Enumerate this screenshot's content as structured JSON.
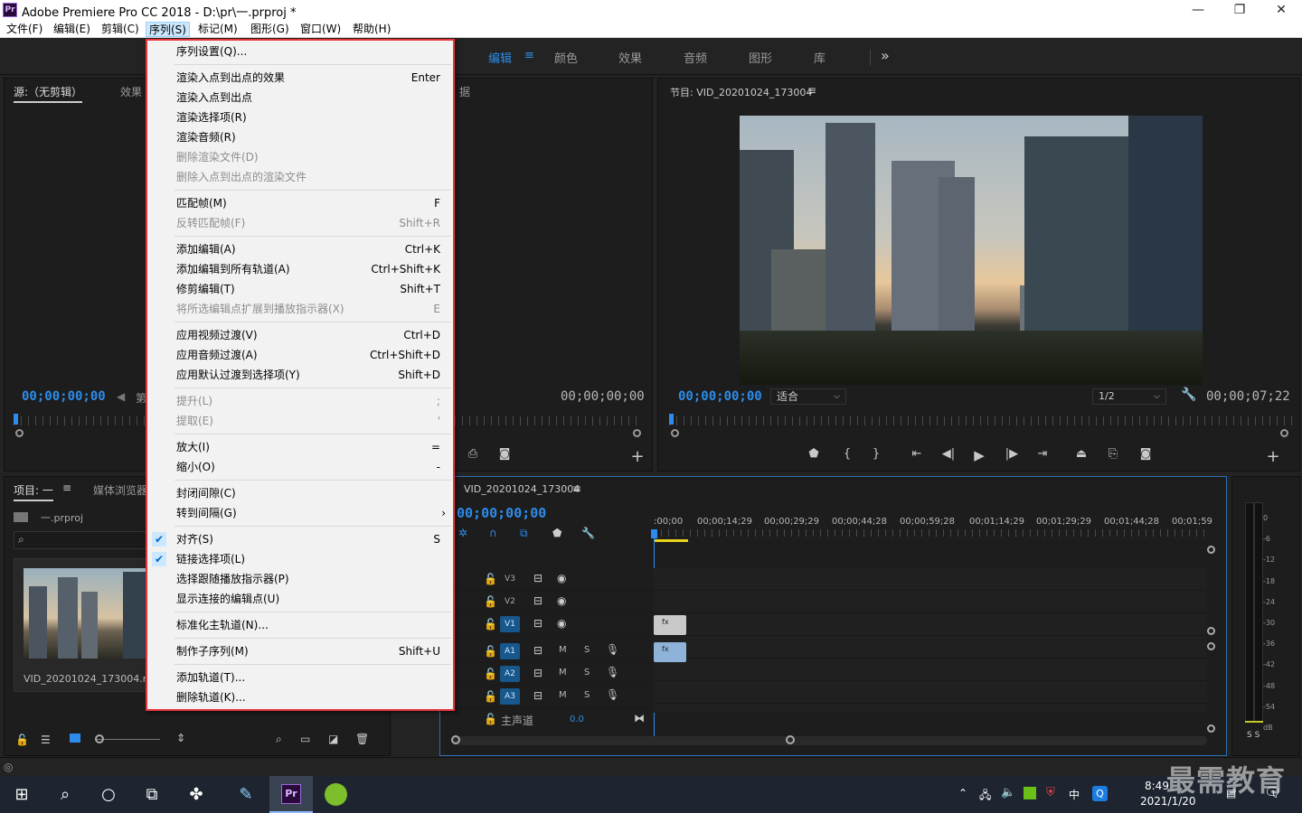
{
  "window": {
    "title": "Adobe Premiere Pro CC 2018 - D:\\pr\\一.prproj *",
    "logo_text": "Pr",
    "minimize": "—",
    "restore": "❐",
    "close": "✕"
  },
  "menubar": [
    {
      "label": "文件(F)"
    },
    {
      "label": "编辑(E)"
    },
    {
      "label": "剪辑(C)"
    },
    {
      "label": "序列(S)",
      "active": true
    },
    {
      "label": "标记(M)"
    },
    {
      "label": "图形(G)"
    },
    {
      "label": "窗口(W)"
    },
    {
      "label": "帮助(H)"
    }
  ],
  "workspace_tabs": [
    {
      "label": "编辑",
      "active": true
    },
    {
      "label": "颜色"
    },
    {
      "label": "效果"
    },
    {
      "label": "音频"
    },
    {
      "label": "图形"
    },
    {
      "label": "库"
    }
  ],
  "workspace_more": "»",
  "source_panel": {
    "tab_source": "源:（无剪辑）",
    "tab_effects": "效果",
    "tab_cut": "第",
    "tab_metadata_tail": "据",
    "timecode_left": "00;00;00;00",
    "timecode_right": "00;00;00;00"
  },
  "program_panel": {
    "title": "节目: VID_20201024_173004",
    "timecode_left": "00;00;00;00",
    "fit": "适合",
    "resolution": "1/2",
    "timecode_right": "00;00;07;22"
  },
  "project_panel": {
    "tab_project": "项目: 一",
    "tab_media": "媒体浏览器",
    "project_file": "一.prproj",
    "clip_name": "VID_20201024_173004.mp4"
  },
  "timeline": {
    "sequence_name": "VID_20201024_173004",
    "timecode": "00;00;00;00",
    "ruler_labels": [
      ":00;00",
      "00;00;14;29",
      "00;00;29;29",
      "00;00;44;28",
      "00;00;59;28",
      "00;01;14;29",
      "00;01;29;29",
      "00;01;44;28",
      "00;01;59"
    ],
    "video_tracks": [
      "V3",
      "V2",
      "V1"
    ],
    "audio_tracks": [
      "A1",
      "A2",
      "A3"
    ],
    "master_label": "主声道",
    "master_value": "0.0",
    "mute": "M",
    "solo": "S"
  },
  "audio_meter": {
    "labels": [
      "0",
      "-6",
      "-12",
      "-18",
      "-24",
      "-30",
      "-36",
      "-42",
      "-48",
      "-54",
      "dB"
    ],
    "solo_labels": "S S"
  },
  "sequence_menu": {
    "groups": [
      [
        {
          "label": "序列设置(Q)...",
          "shortcut": ""
        }
      ],
      [
        {
          "label": "渲染入点到出点的效果",
          "shortcut": "Enter"
        },
        {
          "label": "渲染入点到出点",
          "shortcut": ""
        },
        {
          "label": "渲染选择项(R)",
          "shortcut": ""
        },
        {
          "label": "渲染音频(R)",
          "shortcut": ""
        },
        {
          "label": "删除渲染文件(D)",
          "shortcut": "",
          "disabled": true
        },
        {
          "label": "删除入点到出点的渲染文件",
          "shortcut": "",
          "disabled": true
        }
      ],
      [
        {
          "label": "匹配帧(M)",
          "shortcut": "F"
        },
        {
          "label": "反转匹配帧(F)",
          "shortcut": "Shift+R",
          "disabled": true
        }
      ],
      [
        {
          "label": "添加编辑(A)",
          "shortcut": "Ctrl+K"
        },
        {
          "label": "添加编辑到所有轨道(A)",
          "shortcut": "Ctrl+Shift+K"
        },
        {
          "label": "修剪编辑(T)",
          "shortcut": "Shift+T"
        },
        {
          "label": "将所选编辑点扩展到播放指示器(X)",
          "shortcut": "E",
          "disabled": true
        }
      ],
      [
        {
          "label": "应用视频过渡(V)",
          "shortcut": "Ctrl+D"
        },
        {
          "label": "应用音频过渡(A)",
          "shortcut": "Ctrl+Shift+D"
        },
        {
          "label": "应用默认过渡到选择项(Y)",
          "shortcut": "Shift+D"
        }
      ],
      [
        {
          "label": "提升(L)",
          "shortcut": ";",
          "disabled": true
        },
        {
          "label": "提取(E)",
          "shortcut": "'",
          "disabled": true
        }
      ],
      [
        {
          "label": "放大(I)",
          "shortcut": "="
        },
        {
          "label": "缩小(O)",
          "shortcut": "-"
        }
      ],
      [
        {
          "label": "封闭间隙(C)",
          "shortcut": ""
        },
        {
          "label": "转到间隔(G)",
          "shortcut": "",
          "submenu": true
        }
      ],
      [
        {
          "label": "对齐(S)",
          "shortcut": "S",
          "checked": true
        },
        {
          "label": "链接选择项(L)",
          "shortcut": "",
          "checked": true
        },
        {
          "label": "选择跟随播放指示器(P)",
          "shortcut": ""
        },
        {
          "label": "显示连接的编辑点(U)",
          "shortcut": ""
        }
      ],
      [
        {
          "label": "标准化主轨道(N)...",
          "shortcut": ""
        }
      ],
      [
        {
          "label": "制作子序列(M)",
          "shortcut": "Shift+U"
        }
      ],
      [
        {
          "label": "添加轨道(T)...",
          "shortcut": ""
        },
        {
          "label": "删除轨道(K)...",
          "shortcut": ""
        }
      ]
    ]
  },
  "taskbar": {
    "time": "8:49",
    "date": "2021/1/20",
    "ime": "中",
    "watermark": "最需教育",
    "notification_count": "1"
  },
  "colors": {
    "accent": "#2d8ceb",
    "highlight_border": "#e8343a",
    "track_active": "#17578b"
  }
}
